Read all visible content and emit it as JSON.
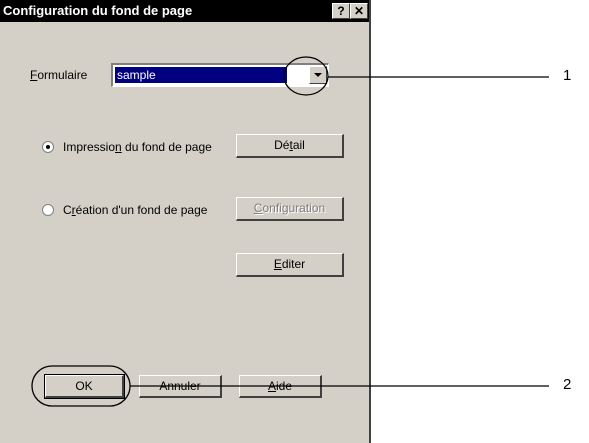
{
  "window": {
    "title": "Configuration du fond de page",
    "help_btn": "?",
    "close_btn": "✕"
  },
  "form": {
    "label_prefix": "F",
    "label_rest": "ormulaire",
    "combo_value": "sample"
  },
  "options": {
    "print_pre": "Impressio",
    "print_u": "n",
    "print_post": " du fond de page",
    "print_selected": true,
    "create_pre": "C",
    "create_u": "r",
    "create_post": "éation d'un fond de page",
    "create_selected": false
  },
  "buttons": {
    "detail_pre": "Dé",
    "detail_u": "t",
    "detail_post": "ail",
    "config_u": "C",
    "config_post": "onfiguration",
    "edit_u": "E",
    "edit_post": "diter",
    "ok": "OK",
    "cancel": "Annuler",
    "help_u": "A",
    "help_post": "ide"
  },
  "callouts": {
    "one": "1",
    "two": "2"
  }
}
